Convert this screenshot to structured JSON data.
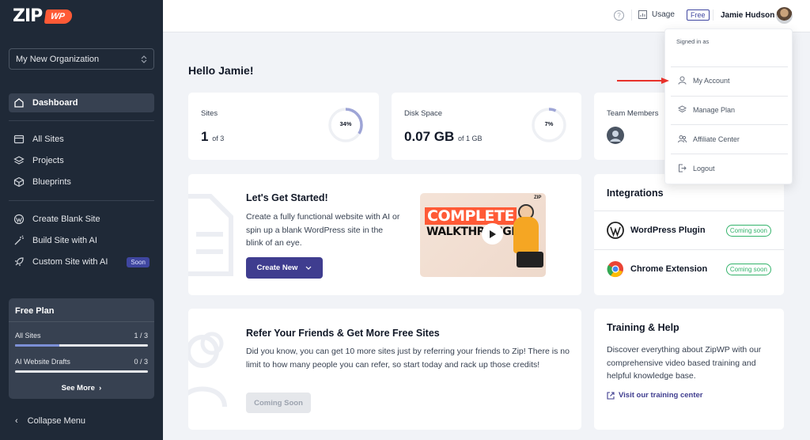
{
  "sidebar": {
    "logo": {
      "zip": "ZIP",
      "wp": "WP"
    },
    "org": "My New Organization",
    "nav": {
      "dashboard": "Dashboard",
      "all_sites": "All Sites",
      "projects": "Projects",
      "blueprints": "Blueprints",
      "create_blank": "Create Blank Site",
      "build_ai": "Build Site with AI",
      "custom_ai": "Custom Site with AI",
      "soon": "Soon"
    },
    "plan": {
      "title": "Free Plan",
      "sites_label": "All Sites",
      "sites_value": "1 / 3",
      "sites_fraction": 0.333,
      "drafts_label": "AI Website Drafts",
      "drafts_value": "0 / 3",
      "drafts_fraction": 0,
      "see_more": "See More"
    },
    "collapse": "Collapse Menu"
  },
  "topbar": {
    "usage": "Usage",
    "plan_badge": "Free",
    "user_name": "Jamie Hudson"
  },
  "main": {
    "greeting": "Hello Jamie!",
    "stats": {
      "sites": {
        "label": "Sites",
        "value": "1",
        "suffix": "of 3",
        "percent_text": "34%",
        "percent": 34
      },
      "disk": {
        "label": "Disk Space",
        "value": "0.07 GB",
        "suffix": "of 1 GB",
        "percent_text": "7%",
        "percent": 7
      },
      "team": {
        "label": "Team Members"
      }
    },
    "get_started": {
      "title": "Let's Get Started!",
      "desc": "Create a fully functional website with AI or spin up a blank WordPress site in the blink of an eye.",
      "button": "Create New",
      "video_line1": "COMPLETE",
      "video_line2": "WALKTHROUGH",
      "video_logo": "ZIP"
    },
    "refer": {
      "title": "Refer Your Friends & Get More Free Sites",
      "desc": "Did you know, you can get 10 more sites just by referring your friends to Zip! There is no limit to how many people you can refer, so start today and rack up those credits!",
      "button": "Coming Soon"
    },
    "integrations": {
      "title": "Integrations",
      "items": [
        {
          "name": "WordPress Plugin",
          "status": "Coming soon"
        },
        {
          "name": "Chrome Extension",
          "status": "Coming soon"
        }
      ]
    },
    "training": {
      "title": "Training & Help",
      "desc": "Discover everything about ZipWP with our comprehensive video based training and helpful knowledge base.",
      "link": "Visit our training center"
    }
  },
  "dropdown": {
    "signed_in_as": "Signed in as",
    "items": {
      "my_account": "My Account",
      "manage_plan": "Manage Plan",
      "affiliate": "Affiliate Center",
      "logout": "Logout"
    }
  },
  "colors": {
    "sidebar_bg": "#1f2937",
    "accent": "#3f3d8f",
    "brand_orange": "#ff5a36",
    "success": "#34b36b",
    "arrow_red": "#e8322b"
  }
}
